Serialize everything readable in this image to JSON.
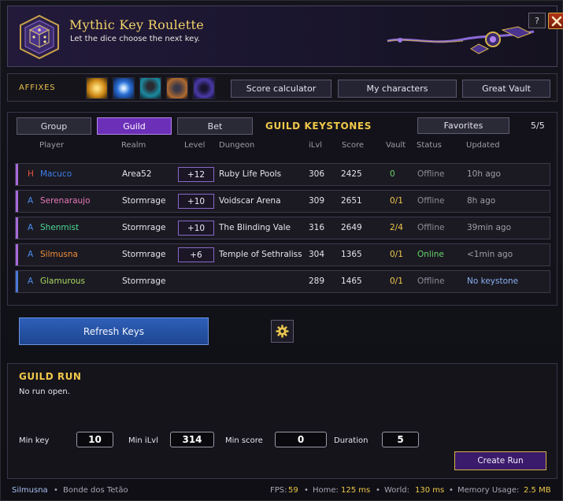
{
  "header": {
    "title": "Mythic Key Roulette",
    "subtitle": "Let the dice choose the next key.",
    "help_label": "?",
    "logo_icon": "dice-crest-icon",
    "close_icon": "close-icon"
  },
  "affix_bar": {
    "label": "AFFIXES",
    "affixes": [
      {
        "icon": "golden-burst-affix-icon",
        "color": "#e0a020"
      },
      {
        "icon": "blue-vortex-affix-icon",
        "color": "#2a70d8"
      },
      {
        "icon": "teal-figure-affix-icon",
        "color": "#1c8aa0"
      },
      {
        "icon": "dark-creature-affix-icon",
        "color": "#b06a30"
      },
      {
        "icon": "purple-shadow-affix-icon",
        "color": "#4a3aa8"
      }
    ],
    "buttons": {
      "score_calculator": "Score calculator",
      "my_characters": "My characters",
      "great_vault": "Great Vault"
    }
  },
  "keystones": {
    "tabs": {
      "group": "Group",
      "guild": "Guild",
      "bet": "Bet"
    },
    "active_tab": "Guild",
    "section_title": "GUILD KEYSTONES",
    "favorites_label": "Favorites",
    "count": "5/5",
    "columns": {
      "player": "Player",
      "realm": "Realm",
      "level": "Level",
      "dungeon": "Dungeon",
      "ilvl": "iLvl",
      "score": "Score",
      "vault": "Vault",
      "status": "Status",
      "updated": "Updated"
    },
    "rows": [
      {
        "role": "H",
        "player": "Macuco",
        "player_color": "#3d7fe8",
        "bar_color": "#a86ad8",
        "realm": "Area52",
        "level": "+12",
        "dungeon": "Ruby Life Pools",
        "ilvl": "306",
        "score": "2425",
        "vault": "0",
        "vault_color": "#6ad06a",
        "status": "Offline",
        "status_color": "#8e8b98",
        "updated": "10h ago",
        "updated_color": "#a09eaa"
      },
      {
        "role": "A",
        "player": "Serenaraujo",
        "player_color": "#e878b8",
        "bar_color": "#a86ad8",
        "realm": "Stormrage",
        "level": "+10",
        "dungeon": "Voidscar Arena",
        "ilvl": "309",
        "score": "2651",
        "vault": "0/1",
        "vault_color": "#f0c84a",
        "status": "Offline",
        "status_color": "#8e8b98",
        "updated": "8h ago",
        "updated_color": "#a09eaa"
      },
      {
        "role": "A",
        "player": "Shenmist",
        "player_color": "#4ad890",
        "bar_color": "#a86ad8",
        "realm": "Stormrage",
        "level": "+10",
        "dungeon": "The Blinding Vale",
        "ilvl": "316",
        "score": "2649",
        "vault": "2/4",
        "vault_color": "#f0c84a",
        "status": "Offline",
        "status_color": "#8e8b98",
        "updated": "39min ago",
        "updated_color": "#a09eaa"
      },
      {
        "role": "A",
        "player": "Silmusna",
        "player_color": "#f08c38",
        "bar_color": "#a86ad8",
        "realm": "Stormrage",
        "level": "+6",
        "dungeon": "Temple of Sethraliss",
        "ilvl": "304",
        "score": "1365",
        "vault": "0/1",
        "vault_color": "#f0c84a",
        "status": "Online",
        "status_color": "#6ad06a",
        "updated": "<1min ago",
        "updated_color": "#a09eaa"
      },
      {
        "role": "A",
        "player": "Glamurous",
        "player_color": "#a8d860",
        "bar_color": "#4a7ad8",
        "realm": "Stormrage",
        "level": "",
        "dungeon": "",
        "ilvl": "289",
        "score": "1465",
        "vault": "0/1",
        "vault_color": "#f0c84a",
        "status": "Offline",
        "status_color": "#8e8b98",
        "updated": "No keystone",
        "updated_color": "#8ab0f0"
      }
    ],
    "role_colors": {
      "H": "#e8543a",
      "A": "#4a8ef0"
    }
  },
  "actions": {
    "refresh_label": "Refresh Keys",
    "gear_icon": "gear-icon"
  },
  "guild_run": {
    "title": "GUILD RUN",
    "status": "No run open.",
    "fields": {
      "min_key": {
        "label": "Min key",
        "value": "10"
      },
      "min_ilvl": {
        "label": "Min iLvl",
        "value": "314"
      },
      "min_score": {
        "label": "Min score",
        "value": "0"
      },
      "duration": {
        "label": "Duration",
        "value": "5"
      }
    },
    "create_label": "Create Run"
  },
  "statusbar": {
    "character": "Silmusna",
    "separator": "•",
    "guild": "Bonde dos Tetão",
    "fps_label": "FPS:",
    "fps": "59",
    "home_label": "Home:",
    "home": "125 ms",
    "world_label": "World:",
    "world": "130 ms",
    "memory_label": "Memory Usage:",
    "memory": "2.5 MB"
  }
}
